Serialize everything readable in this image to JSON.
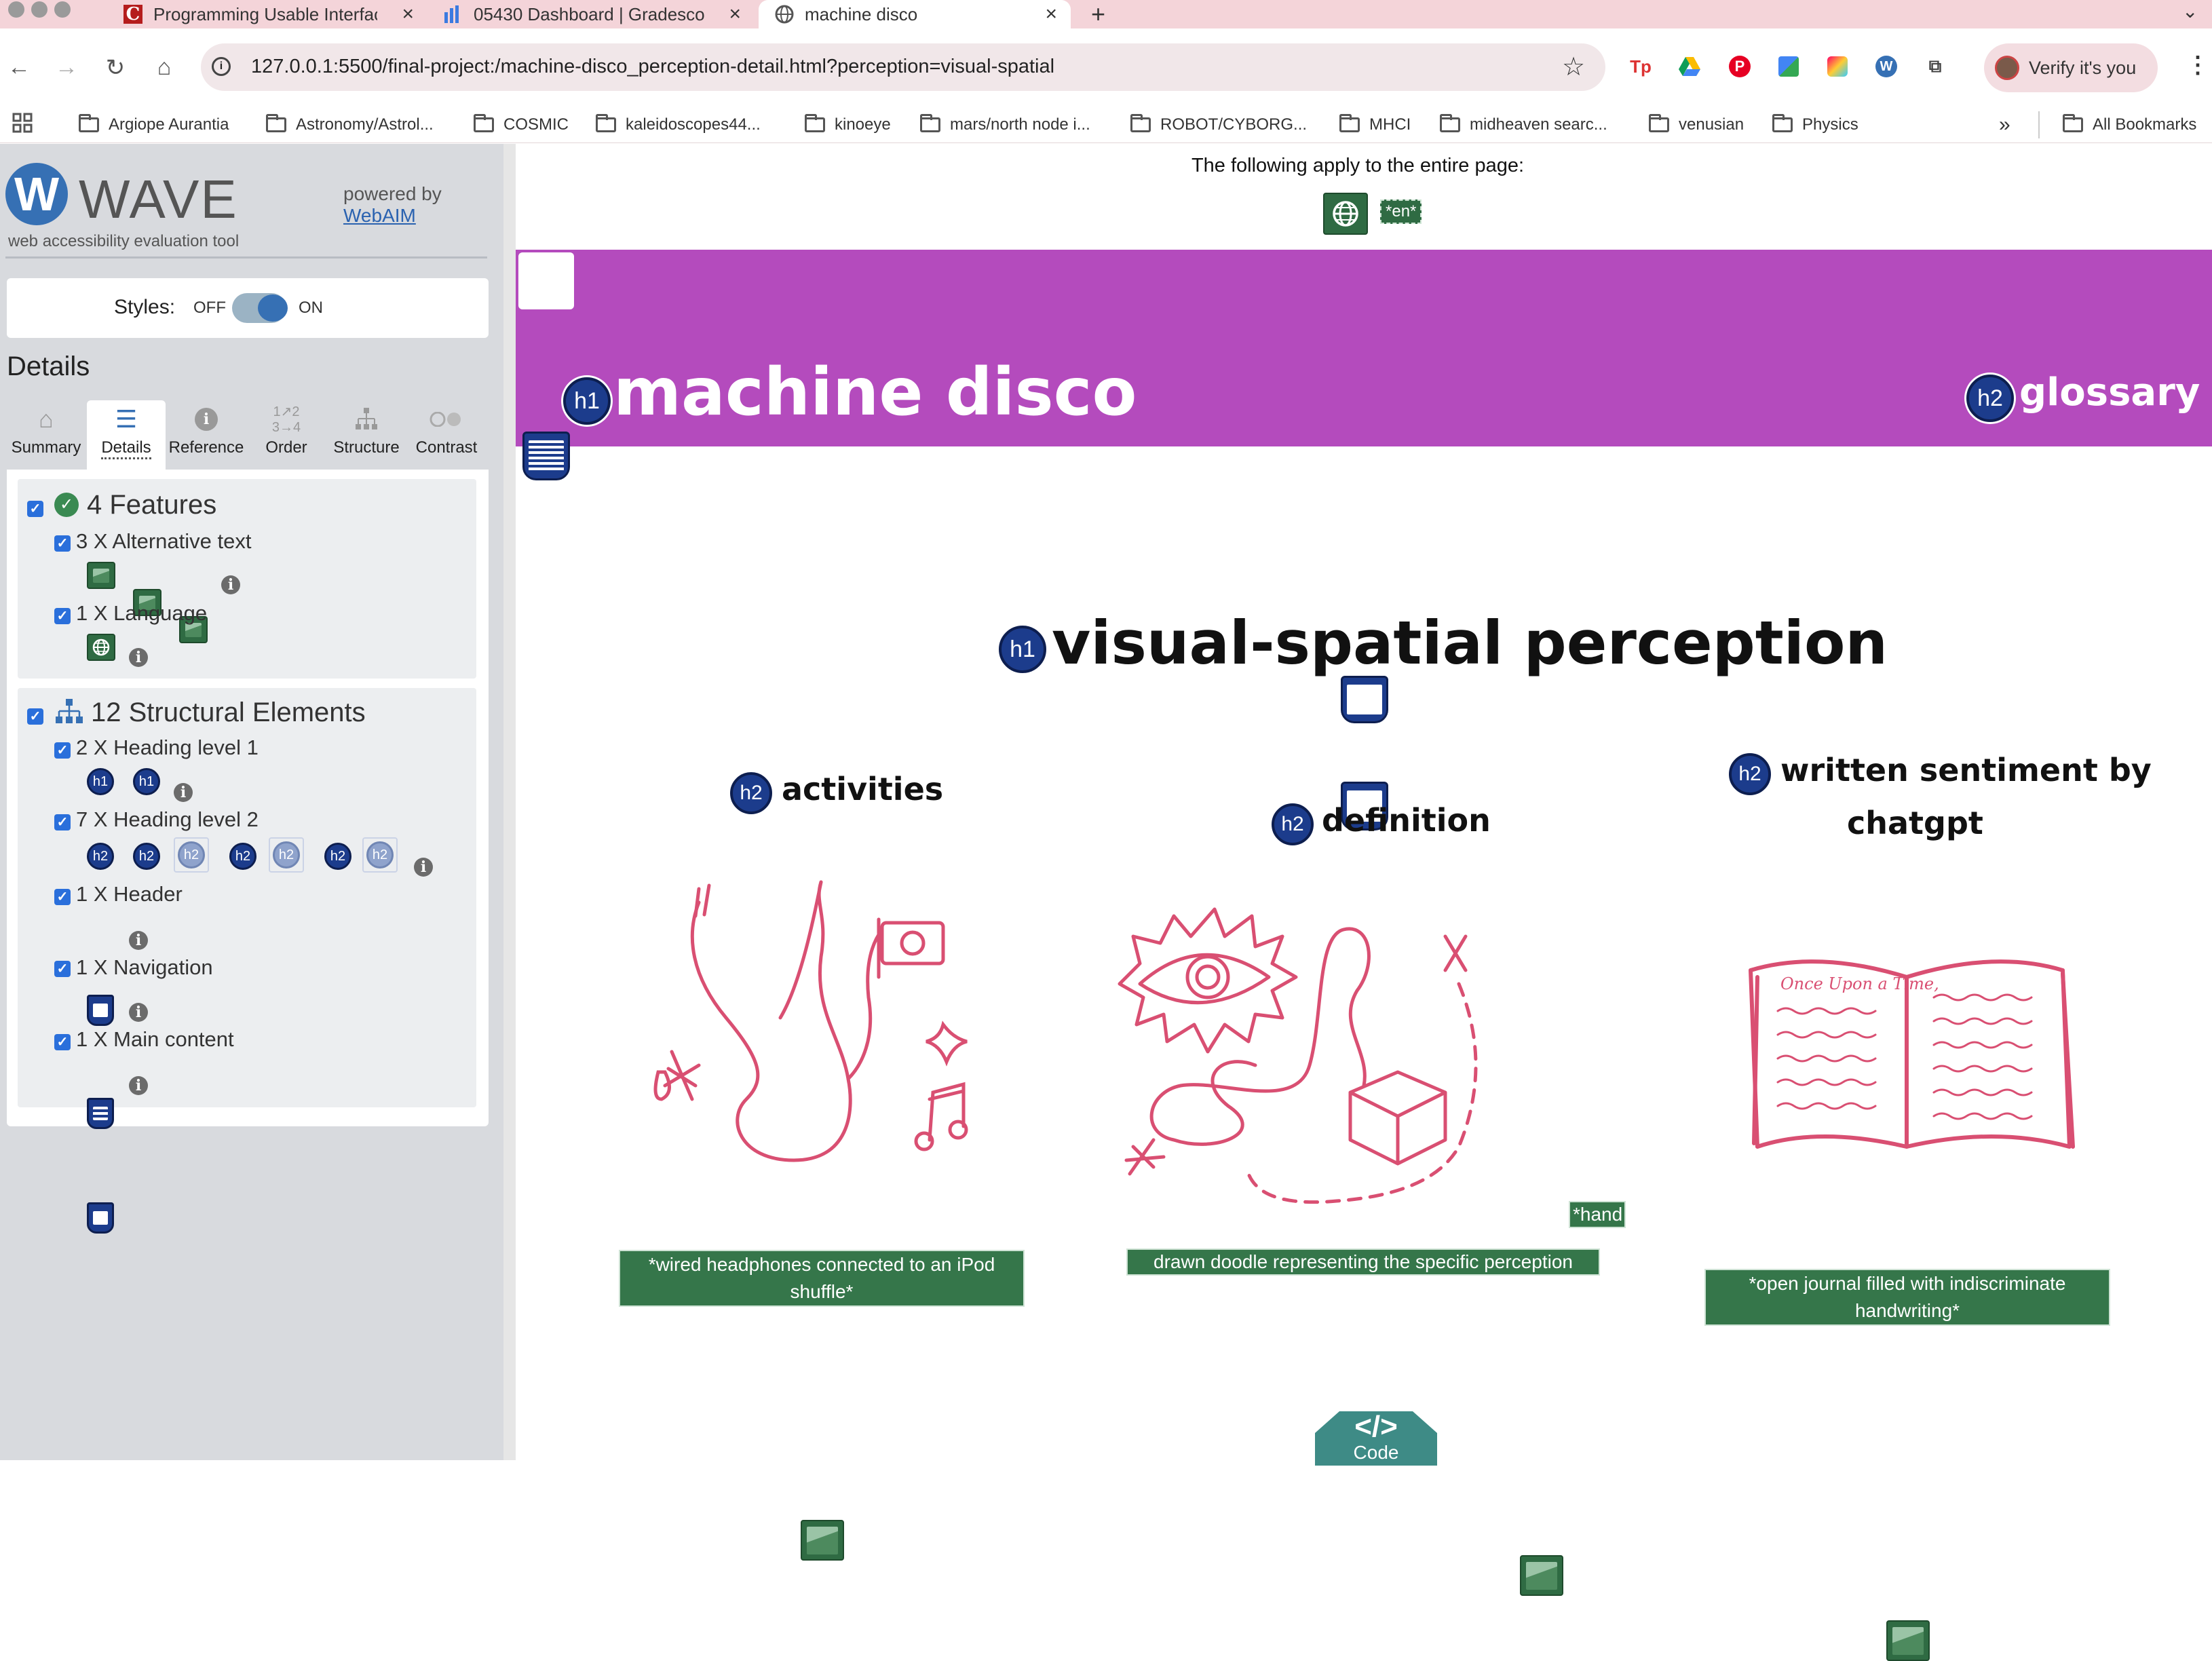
{
  "browser": {
    "tabs": [
      {
        "title": "Programming Usable Interfac",
        "icon": "c-logo-icon",
        "active": false
      },
      {
        "title": "05430 Dashboard | Gradesco",
        "icon": "bar-chart-icon",
        "active": false
      },
      {
        "title": "machine disco",
        "icon": "globe-icon",
        "active": true
      }
    ],
    "url": "127.0.0.1:5500/final-project:/machine-disco_perception-detail.html?perception=visual-spatial",
    "verify_label": "Verify it's you",
    "bookmarks": [
      "Argiope Aurantia",
      "Astronomy/Astrol...",
      "COSMIC",
      "kaleidoscopes44...",
      "kinoeye",
      "mars/north node i...",
      "ROBOT/CYBORG...",
      "MHCI",
      "midheaven searc...",
      "venusian",
      "Physics"
    ],
    "more_bookmarks": "»",
    "all_bookmarks": "All Bookmarks"
  },
  "wave": {
    "logo_letter": "W",
    "brand": "WAVE",
    "tagline": "web accessibility evaluation tool",
    "powered_by": "powered by",
    "webaim": "WebAIM",
    "styles_label": "Styles:",
    "styles_off": "OFF",
    "styles_on": "ON",
    "details_heading": "Details",
    "tabs": [
      "Summary",
      "Details",
      "Reference",
      "Order",
      "Structure",
      "Contrast"
    ],
    "features": {
      "title": "4 Features",
      "alt_text": "3 X Alternative text",
      "language": "1 X Language"
    },
    "structure": {
      "title": "12 Structural Elements",
      "h1": "2 X Heading level 1",
      "h2": "7 X Heading level 2",
      "header": "1 X Header",
      "navigation": "1 X Navigation",
      "main": "1 X Main content"
    },
    "h1_badge": "h1",
    "h2_badge": "h2",
    "info_glyph": "i"
  },
  "page": {
    "entire_page_note": "The following apply to the entire page:",
    "lang_tag": "*en*",
    "site_title": "machine disco",
    "glossary": "glossary",
    "perception_title": "visual-spatial perception",
    "sections": [
      {
        "heading": "activities",
        "alt": "*wired headphones connected to an iPod shuffle*"
      },
      {
        "heading": "definition",
        "alt_part1": "*hand",
        "alt_part2": "drawn doodle representing the specific perception style*"
      },
      {
        "heading_line1": "written sentiment by",
        "heading_line2": "chatgpt",
        "alt": "*open journal filled with indiscriminate handwriting*"
      }
    ],
    "journal_text": "Once Upon a Time,",
    "code_button": "Code",
    "code_glyph": "</>"
  },
  "colors": {
    "header_band": "#b44bbd",
    "doodle_stroke": "#d94f72",
    "wave_blue": "#3670b4",
    "alt_green": "#35764a",
    "heading_badge": "#1c3c8c"
  }
}
